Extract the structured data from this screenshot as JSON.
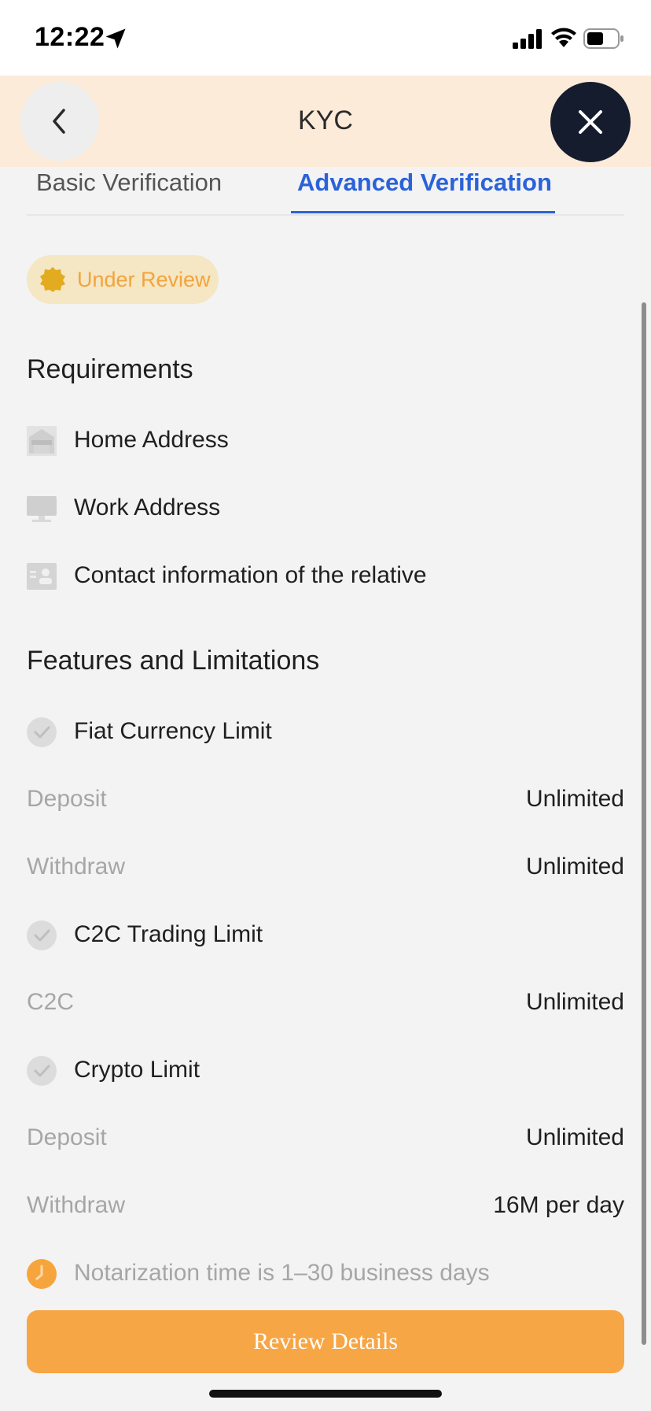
{
  "status_bar": {
    "time": "12:22"
  },
  "header": {
    "title": "KYC"
  },
  "tabs": [
    {
      "label": "Basic Verification",
      "active": false
    },
    {
      "label": "Advanced Verification",
      "active": true
    }
  ],
  "status_badge": {
    "label": "Under Review",
    "color": "#f2a43a"
  },
  "requirements": {
    "title": "Requirements",
    "items": [
      {
        "icon": "house-icon",
        "label": "Home Address"
      },
      {
        "icon": "monitor-icon",
        "label": "Work Address"
      },
      {
        "icon": "contact-card-icon",
        "label": "Contact information of the relative"
      }
    ]
  },
  "features": {
    "title": "Features and Limitations",
    "groups": [
      {
        "icon": "check-circle-icon",
        "label": "Fiat Currency Limit",
        "rows": [
          {
            "key": "Deposit",
            "value": "Unlimited"
          },
          {
            "key": "Withdraw",
            "value": "Unlimited"
          }
        ]
      },
      {
        "icon": "check-circle-icon",
        "label": "C2C Trading Limit",
        "rows": [
          {
            "key": "C2C",
            "value": "Unlimited"
          }
        ]
      },
      {
        "icon": "check-circle-icon",
        "label": "Crypto Limit",
        "rows": [
          {
            "key": "Deposit",
            "value": "Unlimited"
          },
          {
            "key": "Withdraw",
            "value": "16M per day"
          }
        ]
      }
    ],
    "note": {
      "icon": "clock-icon",
      "label": "Notarization time is 1–30 business days"
    }
  },
  "actions": {
    "review_label": "Review Details"
  },
  "colors": {
    "accent_blue": "#2b62d8",
    "button_orange": "#f7a645",
    "header_bg": "#fdebd9",
    "close_bg": "#141c2e"
  }
}
